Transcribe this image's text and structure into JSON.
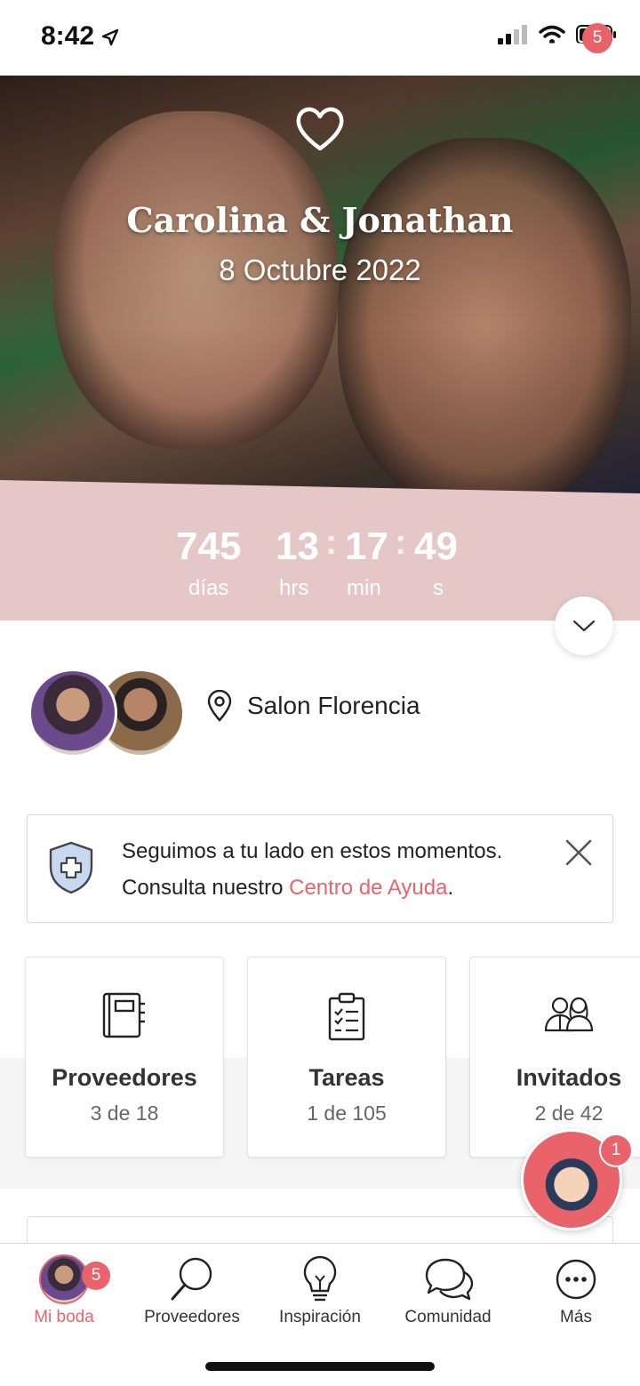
{
  "status_bar": {
    "time": "8:42"
  },
  "hero": {
    "couple_names": "Carolina & Jonathan",
    "wedding_date": "8 Octubre 2022",
    "messages_badge": "5"
  },
  "countdown": {
    "days": "745",
    "days_label": "días",
    "hours": "13",
    "hours_label": "hrs",
    "minutes": "17",
    "minutes_label": "min",
    "seconds": "49",
    "seconds_label": "s",
    "separator": ":"
  },
  "venue": {
    "name": "Salon Florencia"
  },
  "notice": {
    "line1": "Seguimos a tu lado en estos momentos.",
    "line2_prefix": "Consulta nuestro ",
    "link": "Centro de Ayuda",
    "line2_suffix": "."
  },
  "cards": [
    {
      "title": "Proveedores",
      "subtitle": "3 de 18",
      "icon": "vendors-book-icon"
    },
    {
      "title": "Tareas",
      "subtitle": "1 de 105",
      "icon": "checklist-icon"
    },
    {
      "title": "Invitados",
      "subtitle": "2 de 42",
      "icon": "guests-icon"
    }
  ],
  "assistant": {
    "badge": "1"
  },
  "tabbar": {
    "items": [
      {
        "label": "Mi boda",
        "icon": "avatar",
        "badge": "5",
        "active": true
      },
      {
        "label": "Proveedores",
        "icon": "magnifier-icon"
      },
      {
        "label": "Inspiración",
        "icon": "lightbulb-icon"
      },
      {
        "label": "Comunidad",
        "icon": "chat-bubbles-icon"
      },
      {
        "label": "Más",
        "icon": "more-dots-icon"
      }
    ]
  },
  "colors": {
    "accent": "#e9646a",
    "countdown_bg": "#e5c7c8"
  }
}
